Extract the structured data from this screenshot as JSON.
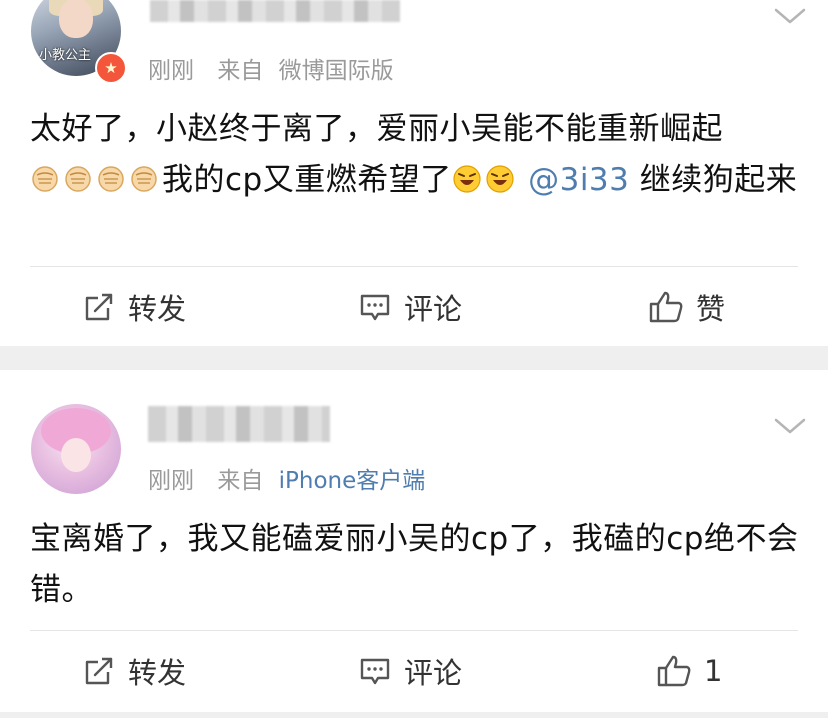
{
  "posts": [
    {
      "avatar_text": "小教公主",
      "verified_badge": "★",
      "time": "刚刚",
      "from": "来自",
      "source": "微博国际版",
      "source_highlight": false,
      "content_text_1": "太好了，小赵终于离了，爱丽小吴能不能重新崛起",
      "content_text_2": "我的cp又重燃希望了",
      "mention": "@3i33",
      "content_text_3": "继续狗起来",
      "emoji_fist": "fist-emoji",
      "emoji_grin": "grin-emoji",
      "actions": {
        "forward": "转发",
        "comment": "评论",
        "like": "赞"
      }
    },
    {
      "time": "刚刚",
      "from": "来自",
      "source": "iPhone客户端",
      "source_highlight": true,
      "content_text": "宝离婚了，我又能磕爱丽小吴的cp了，我磕的cp绝不会错。",
      "actions": {
        "forward": "转发",
        "comment": "评论",
        "like": "1"
      }
    }
  ],
  "colors": {
    "link_blue": "#507daf",
    "meta_gray": "#9a9a9a",
    "separator": "#efefef",
    "badge_red": "#f3563a"
  }
}
